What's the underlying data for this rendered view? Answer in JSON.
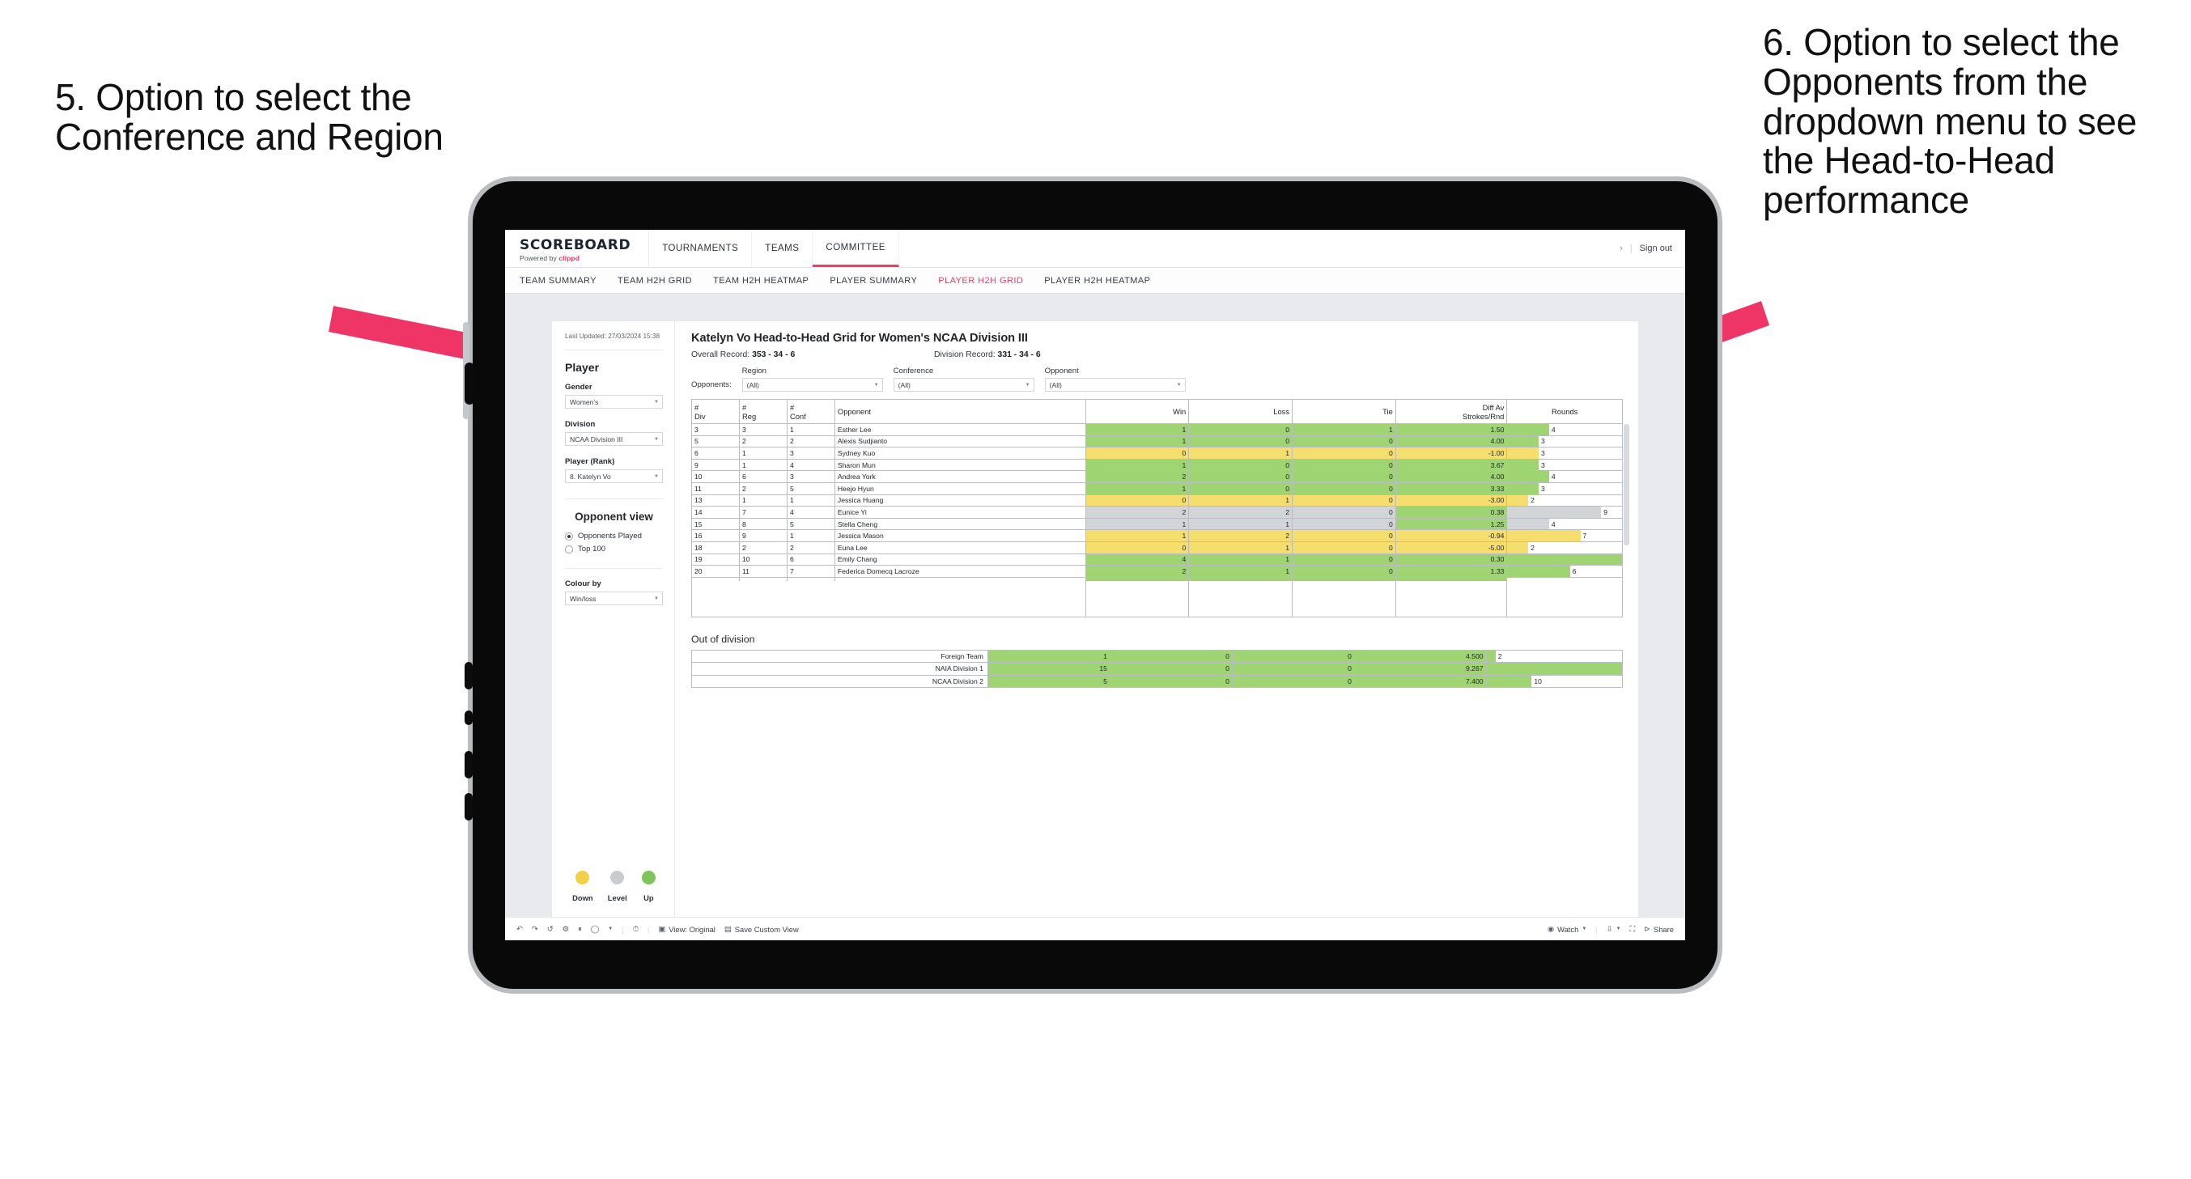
{
  "annotations": {
    "left": "5. Option to select the Conference and Region",
    "right": "6. Option to select the Opponents from the dropdown menu to see the Head-to-Head performance",
    "arrow_color": "#ef3566"
  },
  "topbar": {
    "logo": "SCOREBOARD",
    "logo_sub_prefix": "Powered by ",
    "logo_brand": "clippd",
    "nav": [
      {
        "label": "TOURNAMENTS",
        "active": false
      },
      {
        "label": "TEAMS",
        "active": false
      },
      {
        "label": "COMMITTEE",
        "active": true
      }
    ],
    "chevron": "›",
    "separator": "|",
    "sign_out": "Sign out"
  },
  "subnav": [
    {
      "label": "TEAM SUMMARY",
      "active": false
    },
    {
      "label": "TEAM H2H GRID",
      "active": false
    },
    {
      "label": "TEAM H2H HEATMAP",
      "active": false
    },
    {
      "label": "PLAYER SUMMARY",
      "active": false
    },
    {
      "label": "PLAYER H2H GRID",
      "active": true
    },
    {
      "label": "PLAYER H2H HEATMAP",
      "active": false
    }
  ],
  "sidebar": {
    "last_updated": "Last Updated: 27/03/2024 15:38",
    "player_heading": "Player",
    "fields": [
      {
        "label": "Gender",
        "value": "Women's"
      },
      {
        "label": "Division",
        "value": "NCAA Division III"
      },
      {
        "label": "Player (Rank)",
        "value": "8. Katelyn Vo"
      }
    ],
    "opponent_view_heading": "Opponent view",
    "opponent_view_options": [
      {
        "label": "Opponents Played",
        "selected": true
      },
      {
        "label": "Top 100",
        "selected": false
      }
    ],
    "colour_by_label": "Colour by",
    "colour_by_value": "Win/loss",
    "legend": [
      {
        "label": "Down",
        "color": "#f2d04a"
      },
      {
        "label": "Level",
        "color": "#c8ccd0"
      },
      {
        "label": "Up",
        "color": "#7dc45a"
      }
    ]
  },
  "main": {
    "title": "Katelyn Vo Head-to-Head Grid for Women's NCAA Division III",
    "overall_record_label": "Overall Record: ",
    "overall_record_value": "353 - 34 - 6",
    "division_record_label": "Division Record: ",
    "division_record_value": "331 - 34 - 6",
    "opponents_label": "Opponents:",
    "filters": [
      {
        "label": "Region",
        "value": "(All)"
      },
      {
        "label": "Conference",
        "value": "(All)"
      },
      {
        "label": "Opponent",
        "value": "(All)"
      }
    ],
    "out_of_division_title": "Out of division"
  },
  "chart_data": {
    "type": "table",
    "title": "Katelyn Vo Head-to-Head Grid for Women's NCAA Division III",
    "columns": [
      "# Div",
      "# Reg",
      "# Conf",
      "Opponent",
      "Win",
      "Loss",
      "Tie",
      "Diff Av Strokes/Rnd",
      "Rounds"
    ],
    "rounds_max": 11,
    "rows": [
      {
        "div": "3",
        "reg": "3",
        "conf": "1",
        "opponent": "Esther Lee",
        "win": "1",
        "loss": "0",
        "tie": "1",
        "diff": "1.50",
        "rounds": 4,
        "state": "g"
      },
      {
        "div": "5",
        "reg": "2",
        "conf": "2",
        "opponent": "Alexis Sudjianto",
        "win": "1",
        "loss": "0",
        "tie": "0",
        "diff": "4.00",
        "rounds": 3,
        "state": "g"
      },
      {
        "div": "6",
        "reg": "1",
        "conf": "3",
        "opponent": "Sydney Kuo",
        "win": "0",
        "loss": "1",
        "tie": "0",
        "diff": "-1.00",
        "rounds": 3,
        "state": "y"
      },
      {
        "div": "9",
        "reg": "1",
        "conf": "4",
        "opponent": "Sharon Mun",
        "win": "1",
        "loss": "0",
        "tie": "0",
        "diff": "3.67",
        "rounds": 3,
        "state": "g"
      },
      {
        "div": "10",
        "reg": "6",
        "conf": "3",
        "opponent": "Andrea York",
        "win": "2",
        "loss": "0",
        "tie": "0",
        "diff": "4.00",
        "rounds": 4,
        "state": "g"
      },
      {
        "div": "11",
        "reg": "2",
        "conf": "5",
        "opponent": "Heejo Hyun",
        "win": "1",
        "loss": "0",
        "tie": "0",
        "diff": "3.33",
        "rounds": 3,
        "state": "g"
      },
      {
        "div": "13",
        "reg": "1",
        "conf": "1",
        "opponent": "Jessica Huang",
        "win": "0",
        "loss": "1",
        "tie": "0",
        "diff": "-3.00",
        "rounds": 2,
        "state": "y"
      },
      {
        "div": "14",
        "reg": "7",
        "conf": "4",
        "opponent": "Eunice Yi",
        "win": "2",
        "loss": "2",
        "tie": "0",
        "diff": "0.38",
        "rounds": 9,
        "state": "n",
        "diff_state": "g"
      },
      {
        "div": "15",
        "reg": "8",
        "conf": "5",
        "opponent": "Stella Cheng",
        "win": "1",
        "loss": "1",
        "tie": "0",
        "diff": "1.25",
        "rounds": 4,
        "state": "n",
        "diff_state": "g"
      },
      {
        "div": "16",
        "reg": "9",
        "conf": "1",
        "opponent": "Jessica Mason",
        "win": "1",
        "loss": "2",
        "tie": "0",
        "diff": "-0.94",
        "rounds": 7,
        "state": "y"
      },
      {
        "div": "18",
        "reg": "2",
        "conf": "2",
        "opponent": "Euna Lee",
        "win": "0",
        "loss": "1",
        "tie": "0",
        "diff": "-5.00",
        "rounds": 2,
        "state": "y"
      },
      {
        "div": "19",
        "reg": "10",
        "conf": "6",
        "opponent": "Emily Chang",
        "win": "4",
        "loss": "1",
        "tie": "0",
        "diff": "0.30",
        "rounds": 11,
        "state": "g"
      },
      {
        "div": "20",
        "reg": "11",
        "conf": "7",
        "opponent": "Federica Domecq Lacroze",
        "win": "2",
        "loss": "1",
        "tie": "0",
        "diff": "1.33",
        "rounds": 6,
        "state": "g"
      }
    ],
    "out_of_division": {
      "rounds_max": 30,
      "rows": [
        {
          "name": "Foreign Team",
          "win": "1",
          "loss": "0",
          "tie": "0",
          "diff": "4.500",
          "rounds": 2,
          "state": "g"
        },
        {
          "name": "NAIA Division 1",
          "win": "15",
          "loss": "0",
          "tie": "0",
          "diff": "9.267",
          "rounds": 30,
          "state": "g"
        },
        {
          "name": "NCAA Division 2",
          "win": "5",
          "loss": "0",
          "tie": "0",
          "diff": "7.400",
          "rounds": 10,
          "state": "g"
        }
      ]
    }
  },
  "toolbar": {
    "view_label": "View: Original",
    "save_label": "Save Custom View",
    "watch_label": "Watch",
    "share_label": "Share"
  }
}
